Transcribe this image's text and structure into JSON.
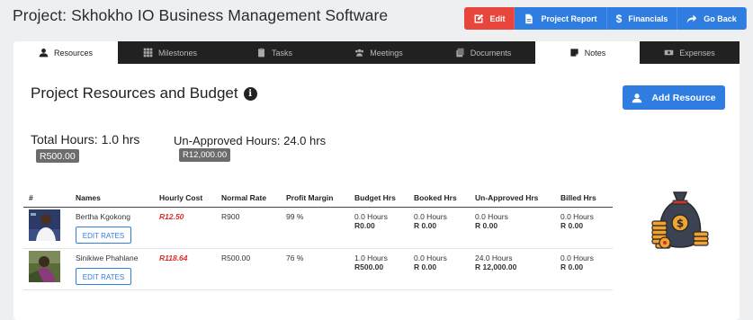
{
  "header": {
    "title": "Project: Skhokho IO Business Management Software",
    "buttons": {
      "edit": "Edit",
      "report": "Project Report",
      "financials": "Financials",
      "back": "Go Back"
    }
  },
  "tabs": [
    "Resources",
    "Milestones",
    "Tasks",
    "Meetings",
    "Documents",
    "Notes",
    "Expenses"
  ],
  "section": {
    "title": "Project Resources and Budget",
    "add_button": "Add Resource",
    "total_hours": "Total Hours: 1.0 hrs",
    "total_amount": "R500.00",
    "unapproved_hours": "Un-Approved Hours: 24.0 hrs",
    "unapproved_amount": "R12,000.00"
  },
  "table": {
    "headers": [
      "#",
      "Names",
      "Hourly Cost",
      "Normal Rate",
      "Profit Margin",
      "Budget Hrs",
      "Booked Hrs",
      "Un-Approved Hrs",
      "Billed Hrs"
    ],
    "edit_label": "EDIT RATES",
    "rows": [
      {
        "name": "Bertha Kgokong",
        "hourly_cost": "R12.50",
        "normal_rate": "R900",
        "profit_margin": "99 %",
        "budget_hrs": "0.0 Hours",
        "budget_amt": "R0.00",
        "booked_hrs": "0.0 Hours",
        "booked_amt": "R 0.00",
        "unapproved_hrs": "0.0 Hours",
        "unapproved_amt": "R 0.00",
        "billed_hrs": "0.0 Hours",
        "billed_amt": "R 0.00"
      },
      {
        "name": "Sinikiwe Phahlane",
        "hourly_cost": "R118.64",
        "normal_rate": "R500.00",
        "profit_margin": "76 %",
        "budget_hrs": "1.0 Hours",
        "budget_amt": "R500.00",
        "booked_hrs": "0.0 Hours",
        "booked_amt": "R 0.00",
        "unapproved_hrs": "24.0 Hours",
        "unapproved_amt": "R 12,000.00",
        "billed_hrs": "0.0 Hours",
        "billed_amt": "R 0.00"
      }
    ]
  },
  "colors": {
    "red": "#e8453c",
    "blue": "#2f7de1",
    "dark_tab": "#212121",
    "badge": "#6c6c6c"
  }
}
